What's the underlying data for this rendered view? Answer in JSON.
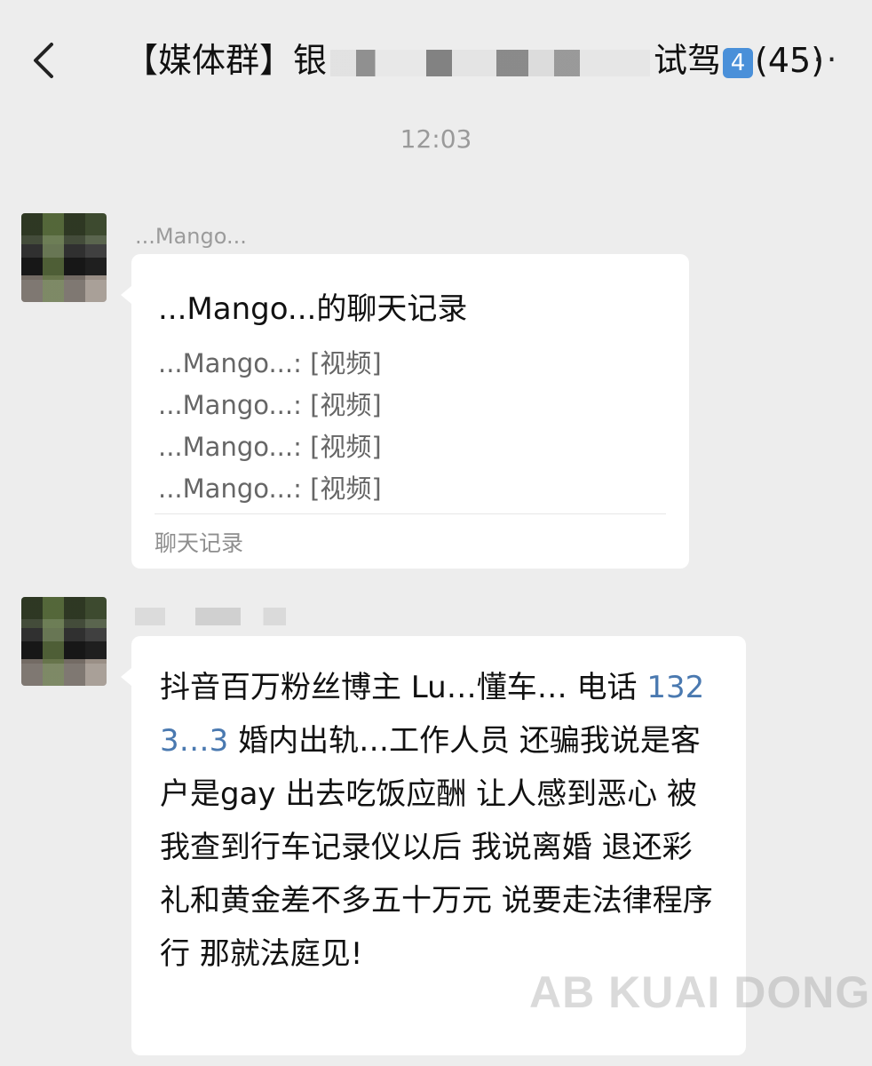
{
  "header": {
    "title_prefix": "【媒体群】银",
    "title_suffix": "试驾",
    "badge": "4",
    "member_count": "(45)",
    "more": "···"
  },
  "timestamp": "12:03",
  "messages": [
    {
      "sender": "...Mango...",
      "type": "chat_record",
      "record_title": "...Mango...的聊天记录",
      "record_lines": [
        "...Mango...: [视频]",
        "...Mango...: [视频]",
        "...Mango...: [视频]",
        "...Mango...: [视频]"
      ],
      "record_footer": "聊天记录"
    },
    {
      "sender": "",
      "type": "text",
      "text_before_phone": "抖音百万粉丝博主 Lu…懂车… 电话 ",
      "phone": "1323…3",
      "text_after_phone": " 婚内出轨…工作人员 还骗我说是客户是gay 出去吃饭应酬 让人感到恶心 被我查到行车记录仪以后 我说离婚 退还彩礼和黄金差不多五十万元 说要走法律程序 行 那就法庭见!"
    }
  ],
  "watermark": "AB KUAI DONG"
}
